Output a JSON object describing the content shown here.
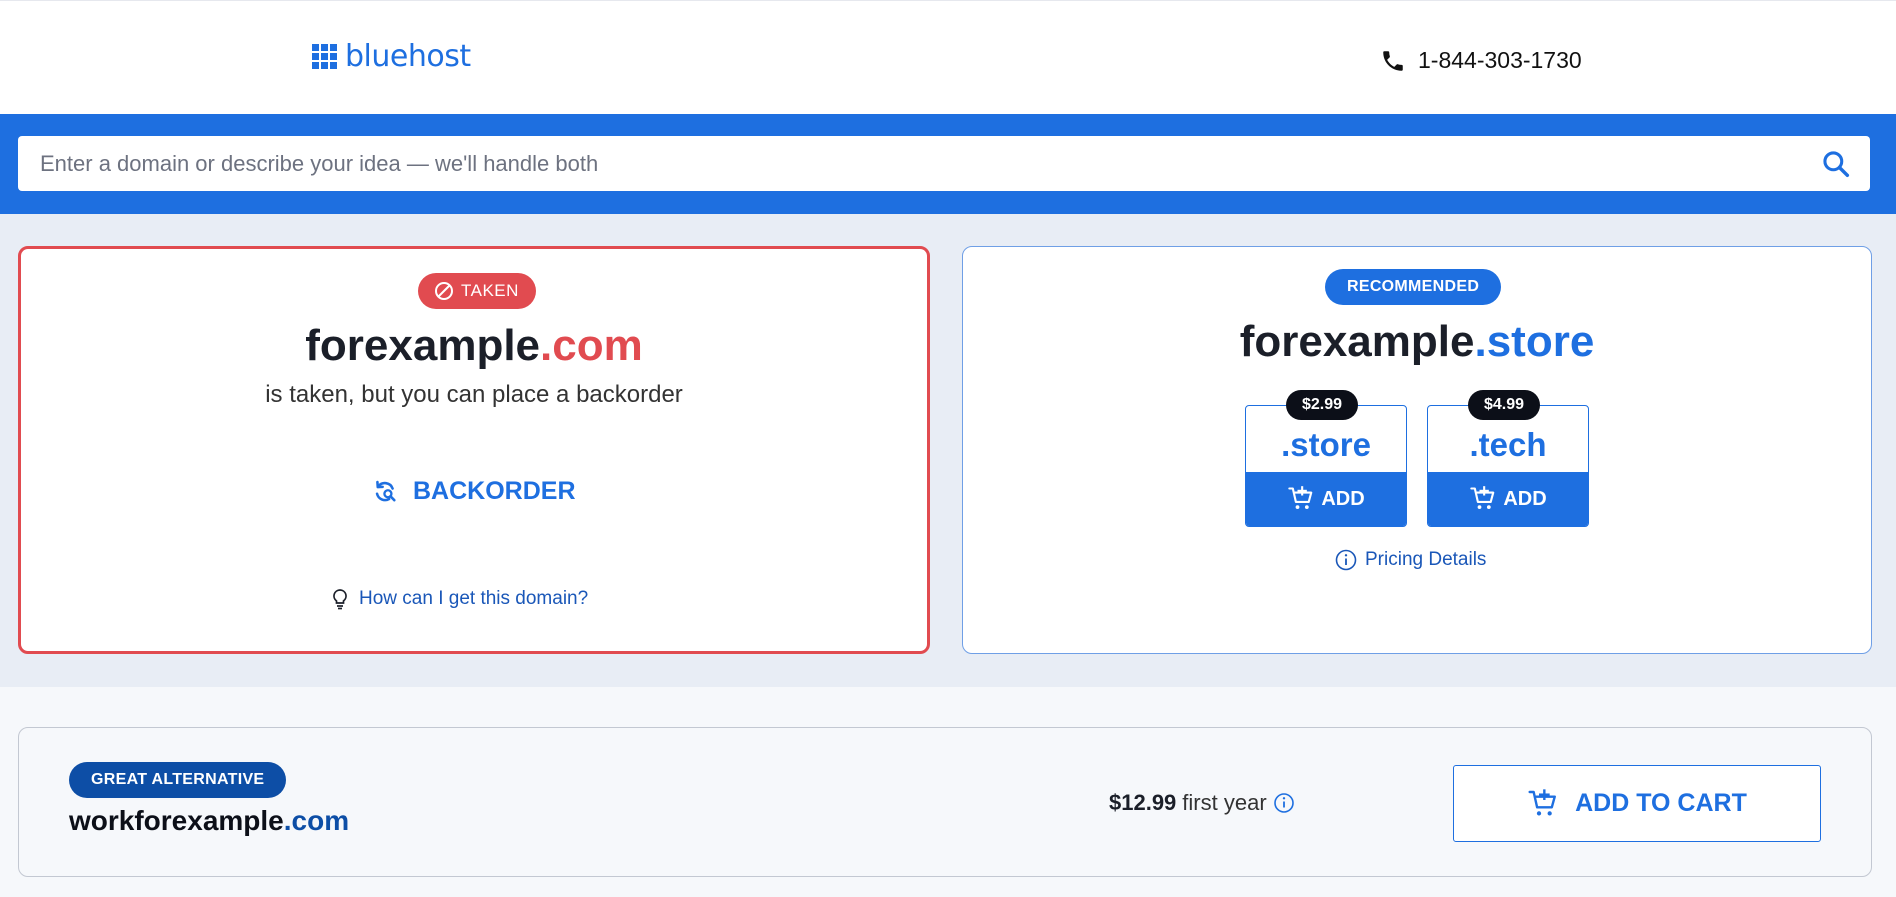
{
  "header": {
    "logo_text": "bluehost",
    "phone": "1-844-303-1730"
  },
  "search": {
    "placeholder": "Enter a domain or describe your idea — we'll handle both",
    "value": ""
  },
  "taken_card": {
    "badge": "TAKEN",
    "domain_name": "forexample",
    "domain_tld": ".com",
    "subtitle": "is taken, but you can place a backorder",
    "backorder_label": "BACKORDER",
    "help_link": "How can I get this domain?"
  },
  "recommended_card": {
    "badge": "RECOMMENDED",
    "domain_name": "forexample",
    "domain_tld": ".store",
    "tiles": [
      {
        "price": "$2.99",
        "tld": ".store",
        "add_label": "ADD"
      },
      {
        "price": "$4.99",
        "tld": ".tech",
        "add_label": "ADD"
      }
    ],
    "pricing_details": "Pricing Details"
  },
  "alternative": {
    "badge": "GREAT ALTERNATIVE",
    "domain_name": "workforexample",
    "domain_tld": ".com",
    "price": "$12.99",
    "price_suffix": "first year",
    "cart_label": "ADD TO CART"
  },
  "colors": {
    "brand_blue": "#1e6fe0",
    "taken_red": "#e14b50",
    "dark_navy": "#0d4ea6",
    "results_bg": "#e8edf5"
  }
}
